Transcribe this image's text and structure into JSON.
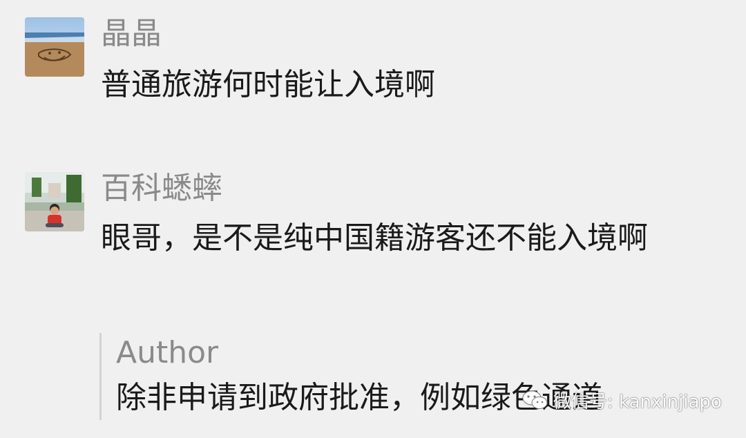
{
  "comments": [
    {
      "nickname": "晶晶",
      "text": "普通旅游何时能让入境啊",
      "avatar_icon": "beach-smiley-avatar-icon"
    },
    {
      "nickname": "百科蟋蟀",
      "text": "眼哥，是不是纯中国籍游客还不能入境啊",
      "avatar_icon": "person-garden-avatar-icon"
    }
  ],
  "author_reply": {
    "author_label": "Author",
    "text": "除非申请到政府批准，例如绿色通道"
  },
  "watermark": {
    "text": "微信号: kanxinjiapo",
    "icon": "wechat-icon"
  },
  "colors": {
    "background": "#f0f0f0",
    "nickname": "#8a8a8a",
    "text": "#1a1a1a",
    "reply_bar": "#d3d3d3"
  }
}
